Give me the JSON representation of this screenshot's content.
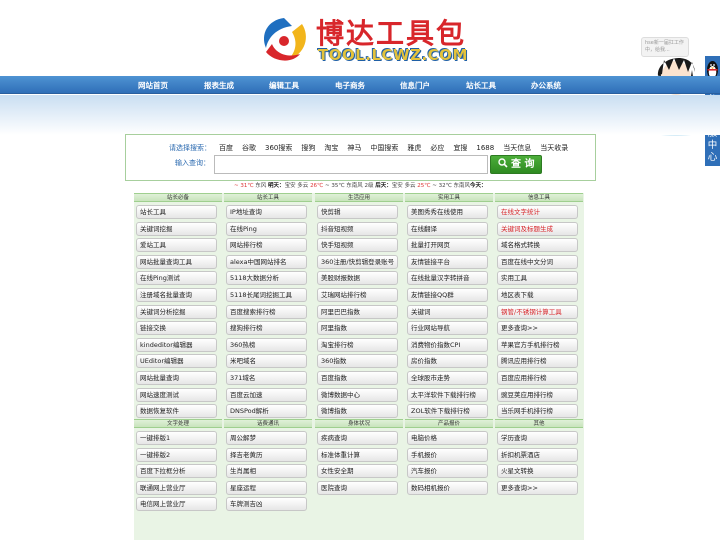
{
  "header": {
    "title": "博达工具包",
    "subtitle": "TOOL.LCWZ.COM"
  },
  "nav": [
    "网站首页",
    "报表生成",
    "编辑工具",
    "电子商务",
    "信息门户",
    "站长工具",
    "办公系统"
  ],
  "chat": {
    "bubble": "hse新一届扛工作中，给我...",
    "side_label": [
      "在",
      "线",
      "客",
      "服",
      "中",
      "心"
    ]
  },
  "search": {
    "engines_label": "请选择搜索：",
    "engines": [
      "百度",
      "谷歌",
      "360搜索",
      "搜狗",
      "淘宝",
      "神马",
      "中国搜索",
      "雅虎",
      "必应",
      "宜搜",
      "1688",
      "当天信息",
      "当天收录"
    ],
    "query_label": "输入查询：",
    "input_value": "",
    "button_label": "查 询"
  },
  "weather": {
    "parts": [
      {
        "text": "~ 31℃",
        "cls": "t"
      },
      {
        "text": " 东风 ",
        "cls": ""
      },
      {
        "text": "明天：",
        "cls": "b"
      },
      {
        "text": "宝安 多云 ",
        "cls": ""
      },
      {
        "text": "26℃",
        "cls": "t"
      },
      {
        "text": " ~ 35℃ 东南风 2级 ",
        "cls": ""
      },
      {
        "text": "后天：",
        "cls": "b"
      },
      {
        "text": "宝安 多云 ",
        "cls": ""
      },
      {
        "text": "25℃",
        "cls": "t"
      },
      {
        "text": " ~ 32℃ 东南风",
        "cls": ""
      },
      {
        "text": "今天：",
        "cls": "b"
      }
    ]
  },
  "colors": {
    "accent_red": "#d8262b",
    "nav_blue": "#2f6fb8",
    "panel_green": "#e9f4e5"
  },
  "sections": [
    [
      {
        "title": "站长必备",
        "items": [
          {
            "label": "站长工具"
          },
          {
            "label": "关键词挖掘"
          },
          {
            "label": "爱站工具"
          },
          {
            "label": "网站批量查询工具"
          },
          {
            "label": "在线Ping测试"
          },
          {
            "label": "注册域名批量查询"
          },
          {
            "label": "关键词分析挖掘"
          },
          {
            "label": "链接交换"
          },
          {
            "label": "kindeditor编辑器"
          },
          {
            "label": "UEditor编辑器"
          },
          {
            "label": "网站批量查询"
          },
          {
            "label": "网站速度测试"
          },
          {
            "label": "数据恢复软件"
          }
        ]
      },
      {
        "title": "站长工具",
        "items": [
          {
            "label": "IP地址查询"
          },
          {
            "label": "在线Ping"
          },
          {
            "label": "网站排行榜"
          },
          {
            "label": "alexa中国网站排名"
          },
          {
            "label": "5118大数据分析"
          },
          {
            "label": "5118长尾词挖掘工具"
          },
          {
            "label": "百度搜索排行榜"
          },
          {
            "label": "搜狗排行榜"
          },
          {
            "label": "360热榜"
          },
          {
            "label": "米吧域名"
          },
          {
            "label": "371域名"
          },
          {
            "label": "百度云加速"
          },
          {
            "label": "DNSPod解析"
          }
        ]
      },
      {
        "title": "生活应用",
        "items": [
          {
            "label": "快剪辑"
          },
          {
            "label": "抖音短视频"
          },
          {
            "label": "快手短视频"
          },
          {
            "label": "360注册/快剪辑登录账号"
          },
          {
            "label": "美股财报数据"
          },
          {
            "label": "艾瑞网站排行榜"
          },
          {
            "label": "阿里巴巴指数"
          },
          {
            "label": "阿里指数"
          },
          {
            "label": "淘宝排行榜"
          },
          {
            "label": "360指数"
          },
          {
            "label": "百度指数"
          },
          {
            "label": "微博数据中心"
          },
          {
            "label": "微博指数"
          }
        ]
      },
      {
        "title": "实用工具",
        "items": [
          {
            "label": "美图秀秀在线使用"
          },
          {
            "label": "在线翻译"
          },
          {
            "label": "批量打开网页"
          },
          {
            "label": "友情链接平台"
          },
          {
            "label": "在线批量汉字转拼音"
          },
          {
            "label": "友情链接QQ群"
          },
          {
            "label": "关键词"
          },
          {
            "label": "行业网站导航"
          },
          {
            "label": "消费物价指数CPI"
          },
          {
            "label": "房价指数"
          },
          {
            "label": "全球股市走势"
          },
          {
            "label": "太平洋软件下载排行榜"
          },
          {
            "label": "ZOL软件下载排行榜"
          }
        ]
      },
      {
        "title": "信息工具",
        "items": [
          {
            "label": "在线文字统计",
            "red": true
          },
          {
            "label": "关键词及标题生成",
            "red": true
          },
          {
            "label": "域名格式转换"
          },
          {
            "label": "百度在线中文分词"
          },
          {
            "label": "实用工具"
          },
          {
            "label": "地区表下载"
          },
          {
            "label": "钢管/不锈钢计算工具",
            "red": true
          },
          {
            "label": "更多查询>>"
          },
          {
            "label": "苹果官方手机排行榜"
          },
          {
            "label": "腾讯应用排行榜"
          },
          {
            "label": "百度应用排行榜"
          },
          {
            "label": "豌豆荚应用排行榜"
          },
          {
            "label": "当乐网手机排行榜"
          }
        ]
      }
    ],
    [
      {
        "title": "文字处理",
        "items": [
          {
            "label": "一键排版1"
          },
          {
            "label": "一键排版2"
          },
          {
            "label": "百度下拉框分析"
          },
          {
            "label": "联通网上营业厅"
          },
          {
            "label": "电信网上营业厅"
          }
        ]
      },
      {
        "title": "话费通讯",
        "items": [
          {
            "label": "周公解梦"
          },
          {
            "label": "择吉老黄历"
          },
          {
            "label": "生肖属相"
          },
          {
            "label": "星座运程"
          },
          {
            "label": "车牌测吉凶"
          }
        ]
      },
      {
        "title": "身体状况",
        "items": [
          {
            "label": "疾病查询"
          },
          {
            "label": "标准体重计算"
          },
          {
            "label": "女性安全期"
          },
          {
            "label": "医院查询"
          }
        ]
      },
      {
        "title": "产品报价",
        "items": [
          {
            "label": "电脑价格"
          },
          {
            "label": "手机报价"
          },
          {
            "label": "汽车报价"
          },
          {
            "label": "数码相机报价"
          }
        ]
      },
      {
        "title": "其他",
        "items": [
          {
            "label": "学历查询"
          },
          {
            "label": "折扣机票酒店"
          },
          {
            "label": "火星文转换"
          },
          {
            "label": "更多查询>>"
          }
        ]
      }
    ]
  ]
}
